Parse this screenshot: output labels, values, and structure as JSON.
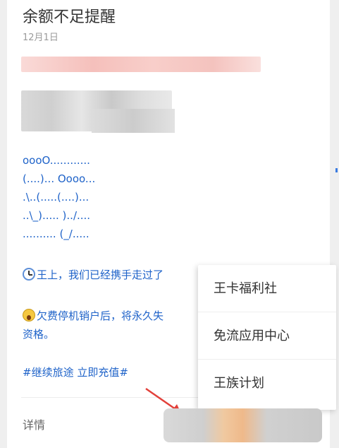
{
  "message": {
    "title": "余额不足提醒",
    "date": "12月1日",
    "ascii_art": [
      "oooO............",
      "(....)... Oooo...",
      ".\\..(.....(....)...",
      "..\\_)..... )../....",
      ".......... (_/....."
    ],
    "line1": "王上，我们已经携手走过了",
    "line2a": "欠费停机销户后，将永久失",
    "line2b": "资格。",
    "hashtag": "#继续旅途 立即充值#"
  },
  "footer": {
    "detail_label": "详情"
  },
  "popup_menu": {
    "items": [
      {
        "label": "王卡福利社"
      },
      {
        "label": "免流应用中心"
      },
      {
        "label": "王族计划"
      }
    ]
  },
  "colors": {
    "link_blue": "#1f63c9",
    "arrow_red": "#e2403a"
  },
  "icons": {
    "clock": "clock-emoji-icon",
    "scream": "scream-emoji-icon",
    "arrow": "red-arrow-icon"
  }
}
